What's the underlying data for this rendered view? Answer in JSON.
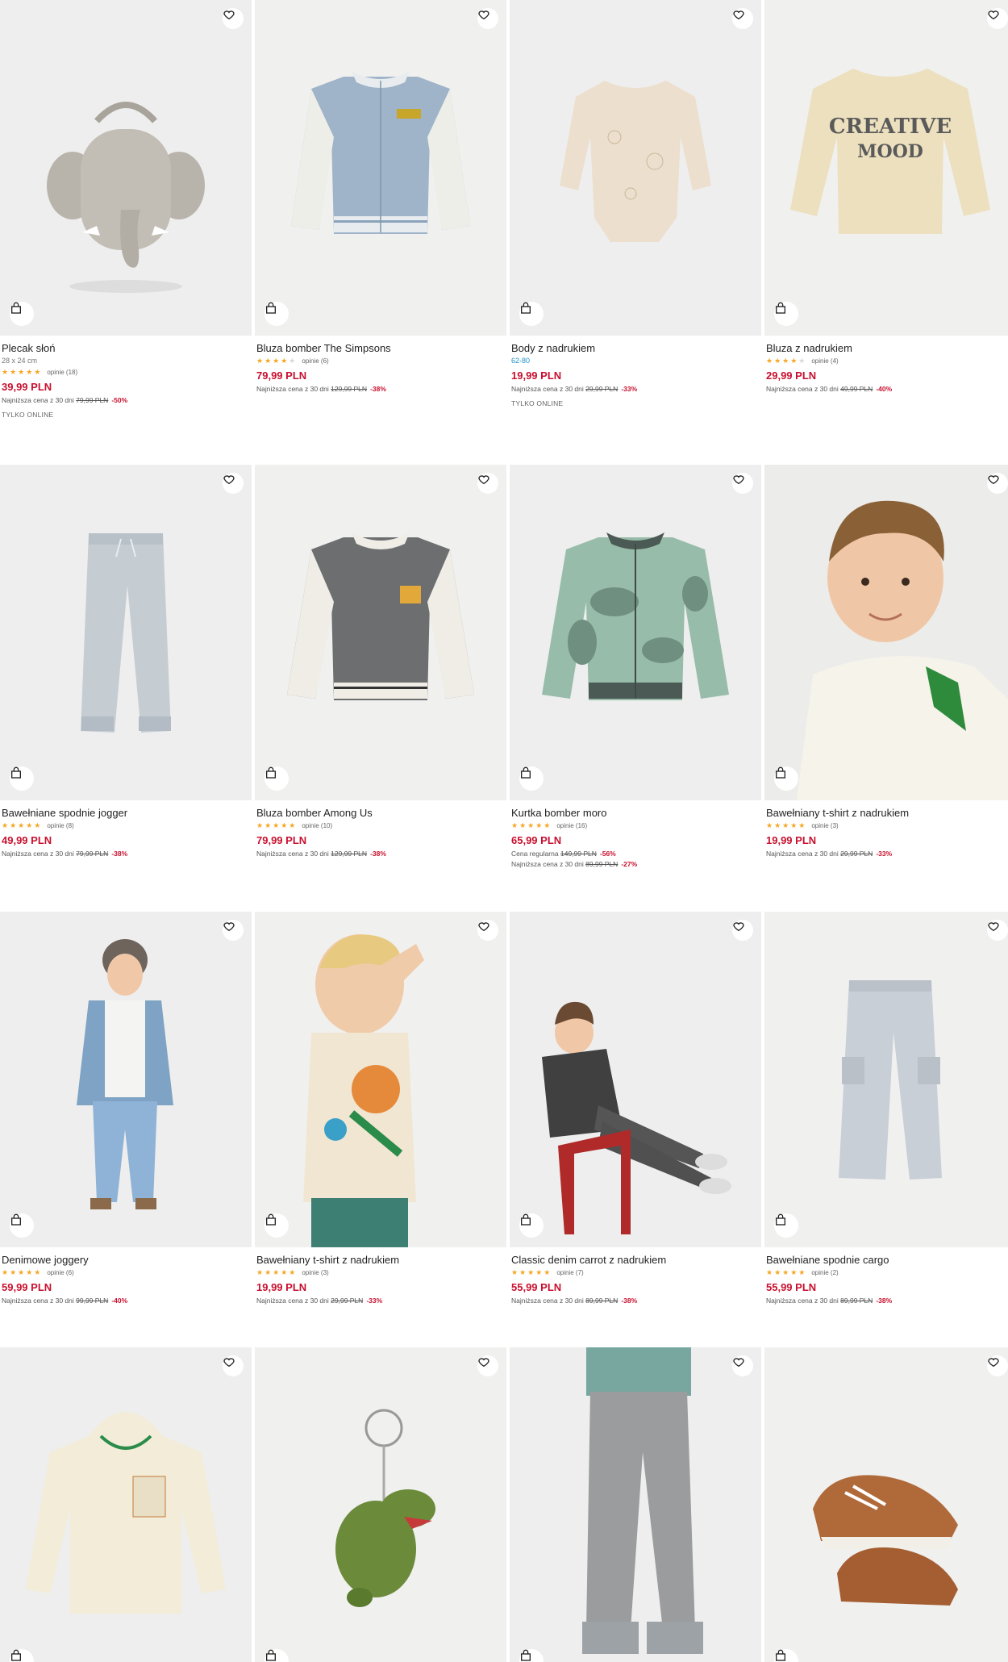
{
  "products": [
    {
      "name": "Plecak słoń",
      "size": "28 x 24 cm",
      "stars": 5,
      "reviews": "opinie (18)",
      "price": "39,99 PLN",
      "lines": [
        {
          "label": "Najniższa cena z 30 dni",
          "old": "79,99 PLN",
          "disc": "-50%"
        }
      ],
      "badge": "TYLKO ONLINE",
      "icon": "elephant-backpack"
    },
    {
      "name": "Bluza bomber The Simpsons",
      "stars": 4,
      "reviews": "opinie (6)",
      "price": "79,99 PLN",
      "lines": [
        {
          "label": "Najniższa cena z 30 dni",
          "old": "129,99 PLN",
          "disc": "-38%"
        }
      ],
      "icon": "bomber-jacket-blue"
    },
    {
      "name": "Body z nadrukiem",
      "size": "62-80",
      "size_blue": true,
      "price": "19,99 PLN",
      "lines": [
        {
          "label": "Najniższa cena z 30 dni",
          "old": "29,99 PLN",
          "disc": "-33%"
        }
      ],
      "badge": "TYLKO ONLINE",
      "icon": "baby-bodysuit"
    },
    {
      "name": "Bluza z nadrukiem",
      "stars": 4,
      "reviews": "opinie (4)",
      "price": "29,99 PLN",
      "lines": [
        {
          "label": "Najniższa cena z 30 dni",
          "old": "49,99 PLN",
          "disc": "-40%"
        }
      ],
      "icon": "sweatshirt-creative-mood"
    },
    {
      "name": "Bawełniane spodnie jogger",
      "stars": 5,
      "reviews": "opinie (8)",
      "price": "49,99 PLN",
      "lines": [
        {
          "label": "Najniższa cena z 30 dni",
          "old": "79,99 PLN",
          "disc": "-38%"
        }
      ],
      "icon": "jogger-pants"
    },
    {
      "name": "Bluza bomber Among Us",
      "stars": 4.5,
      "reviews": "opinie (10)",
      "price": "79,99 PLN",
      "lines": [
        {
          "label": "Najniższa cena z 30 dni",
          "old": "129,99 PLN",
          "disc": "-38%"
        }
      ],
      "icon": "bomber-jacket-grey"
    },
    {
      "name": "Kurtka bomber moro",
      "stars": 5,
      "reviews": "opinie (16)",
      "price": "65,99 PLN",
      "lines": [
        {
          "label": "Cena regularna",
          "old": "149,99 PLN",
          "disc": "-56%"
        },
        {
          "label": "Najniższa cena z 30 dni",
          "old": "89,99 PLN",
          "disc": "-27%"
        }
      ],
      "icon": "camo-bomber-jacket"
    },
    {
      "name": "Bawełniany t-shirt z nadrukiem",
      "stars": 4.5,
      "reviews": "opinie (3)",
      "price": "19,99 PLN",
      "lines": [
        {
          "label": "Najniższa cena z 30 dni",
          "old": "29,99 PLN",
          "disc": "-33%"
        }
      ],
      "icon": "boy-tshirt"
    },
    {
      "name": "Denimowe joggery",
      "stars": 5,
      "reviews": "opinie (6)",
      "price": "59,99 PLN",
      "lines": [
        {
          "label": "Najniższa cena z 30 dni",
          "old": "99,99 PLN",
          "disc": "-40%"
        }
      ],
      "icon": "boy-denim"
    },
    {
      "name": "Bawełniany t-shirt z nadrukiem",
      "stars": 4.5,
      "reviews": "opinie (3)",
      "price": "19,99 PLN",
      "lines": [
        {
          "label": "Najniższa cena z 30 dni",
          "old": "29,99 PLN",
          "disc": "-33%"
        }
      ],
      "icon": "boy-printed-tshirt"
    },
    {
      "name": "Classic denim carrot z nadrukiem",
      "stars": 4.5,
      "reviews": "opinie (7)",
      "price": "55,99 PLN",
      "lines": [
        {
          "label": "Najniższa cena z 30 dni",
          "old": "89,99 PLN",
          "disc": "-38%"
        }
      ],
      "icon": "boy-on-chair"
    },
    {
      "name": "Bawełniane spodnie cargo",
      "stars": 5,
      "reviews": "opinie (2)",
      "price": "55,99 PLN",
      "lines": [
        {
          "label": "Najniższa cena z 30 dni",
          "old": "89,99 PLN",
          "disc": "-38%"
        }
      ],
      "icon": "cargo-pants"
    },
    {
      "name": "",
      "icon": "hoodie"
    },
    {
      "name": "",
      "icon": "dino-keychain"
    },
    {
      "name": "",
      "icon": "grey-jeans"
    },
    {
      "name": "",
      "icon": "sneakers"
    }
  ],
  "colors": {
    "price": "#c8102e",
    "star": "#f5a623",
    "size_blue": "#1d8fc9"
  }
}
